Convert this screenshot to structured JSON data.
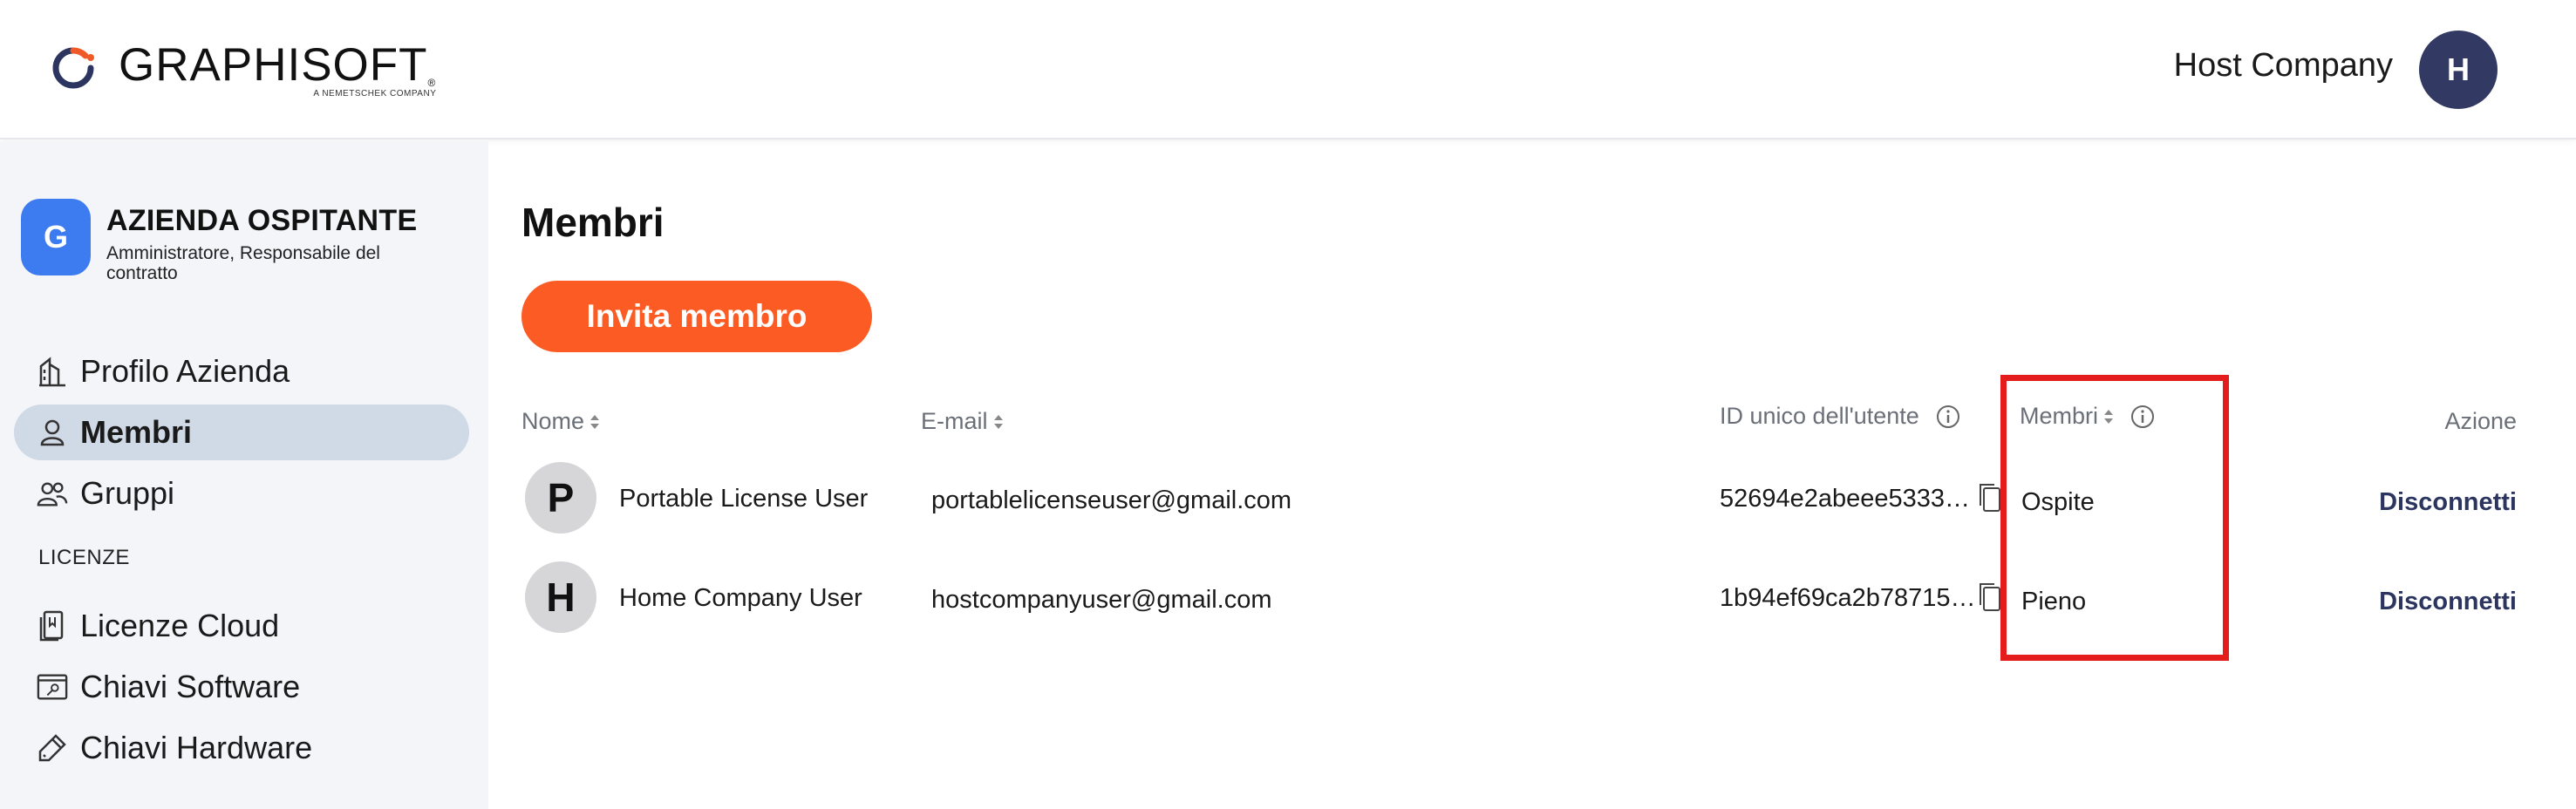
{
  "header": {
    "brand": "GRAPHISOFT",
    "brand_mark": "®",
    "brand_sub": "A NEMETSCHEK COMPANY",
    "company_name": "Host Company",
    "user_initial": "H",
    "colors": {
      "brand_orange": "#f05a28",
      "avatar": "#323a63"
    }
  },
  "sidebar": {
    "org": {
      "initial": "G",
      "title": "AZIENDA OSPITANTE",
      "role": "Amministratore, Responsabile del contratto"
    },
    "items": [
      {
        "label": "Profilo Azienda",
        "icon": "building-icon",
        "active": false
      },
      {
        "label": "Membri",
        "icon": "person-icon",
        "active": true
      },
      {
        "label": "Gruppi",
        "icon": "group-icon",
        "active": false
      }
    ],
    "section_label": "LICENZE",
    "license_items": [
      {
        "label": "Licenze Cloud",
        "icon": "cloud-license-icon"
      },
      {
        "label": "Chiavi Software",
        "icon": "software-key-icon"
      },
      {
        "label": "Chiavi Hardware",
        "icon": "hardware-key-icon"
      }
    ]
  },
  "main": {
    "title": "Membri",
    "invite_label": "Invita membro",
    "columns": {
      "name": "Nome",
      "email": "E-mail",
      "uid": "ID unico dell'utente",
      "membership": "Membri",
      "action": "Azione"
    },
    "rows": [
      {
        "initial": "P",
        "name": "Portable License User",
        "email": "portablelicenseuser@gmail.com",
        "uid": "52694e2abeee5333…",
        "membership": "Ospite",
        "action": "Disconnetti"
      },
      {
        "initial": "H",
        "name": "Home Company User",
        "email": "hostcompanyuser@gmail.com",
        "uid": "1b94ef69ca2b78715…",
        "membership": "Pieno",
        "action": "Disconnetti"
      }
    ],
    "colors": {
      "invite_button": "#fc5b23",
      "highlight": "#e41c1c",
      "action_link": "#2b3560"
    }
  }
}
